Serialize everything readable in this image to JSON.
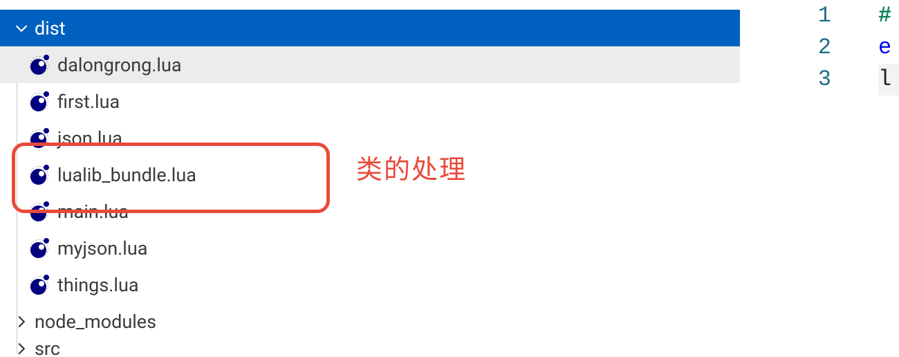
{
  "colors": {
    "selection": "#0060c0",
    "annotation": "#e84a3a"
  },
  "sidebar": {
    "root": {
      "name": "dist",
      "expanded": true
    },
    "files": [
      {
        "name": "dalongrong.lua",
        "active": true
      },
      {
        "name": "first.lua",
        "active": false
      },
      {
        "name": "json.lua",
        "active": false
      },
      {
        "name": "lualib_bundle.lua",
        "active": false
      },
      {
        "name": "main.lua",
        "active": false
      },
      {
        "name": "myjson.lua",
        "active": false
      },
      {
        "name": "things.lua",
        "active": false
      }
    ],
    "siblings": [
      {
        "name": "node_modules",
        "expanded": false
      },
      {
        "name": "src",
        "expanded": false
      }
    ]
  },
  "annotation": {
    "text": "类的处理"
  },
  "editor": {
    "lines": [
      {
        "n": "1",
        "frag": "#",
        "cls": "tok-hash"
      },
      {
        "n": "2",
        "frag": "e",
        "cls": "tok-e"
      },
      {
        "n": "3",
        "frag": "l",
        "cls": "tok-l"
      }
    ]
  }
}
